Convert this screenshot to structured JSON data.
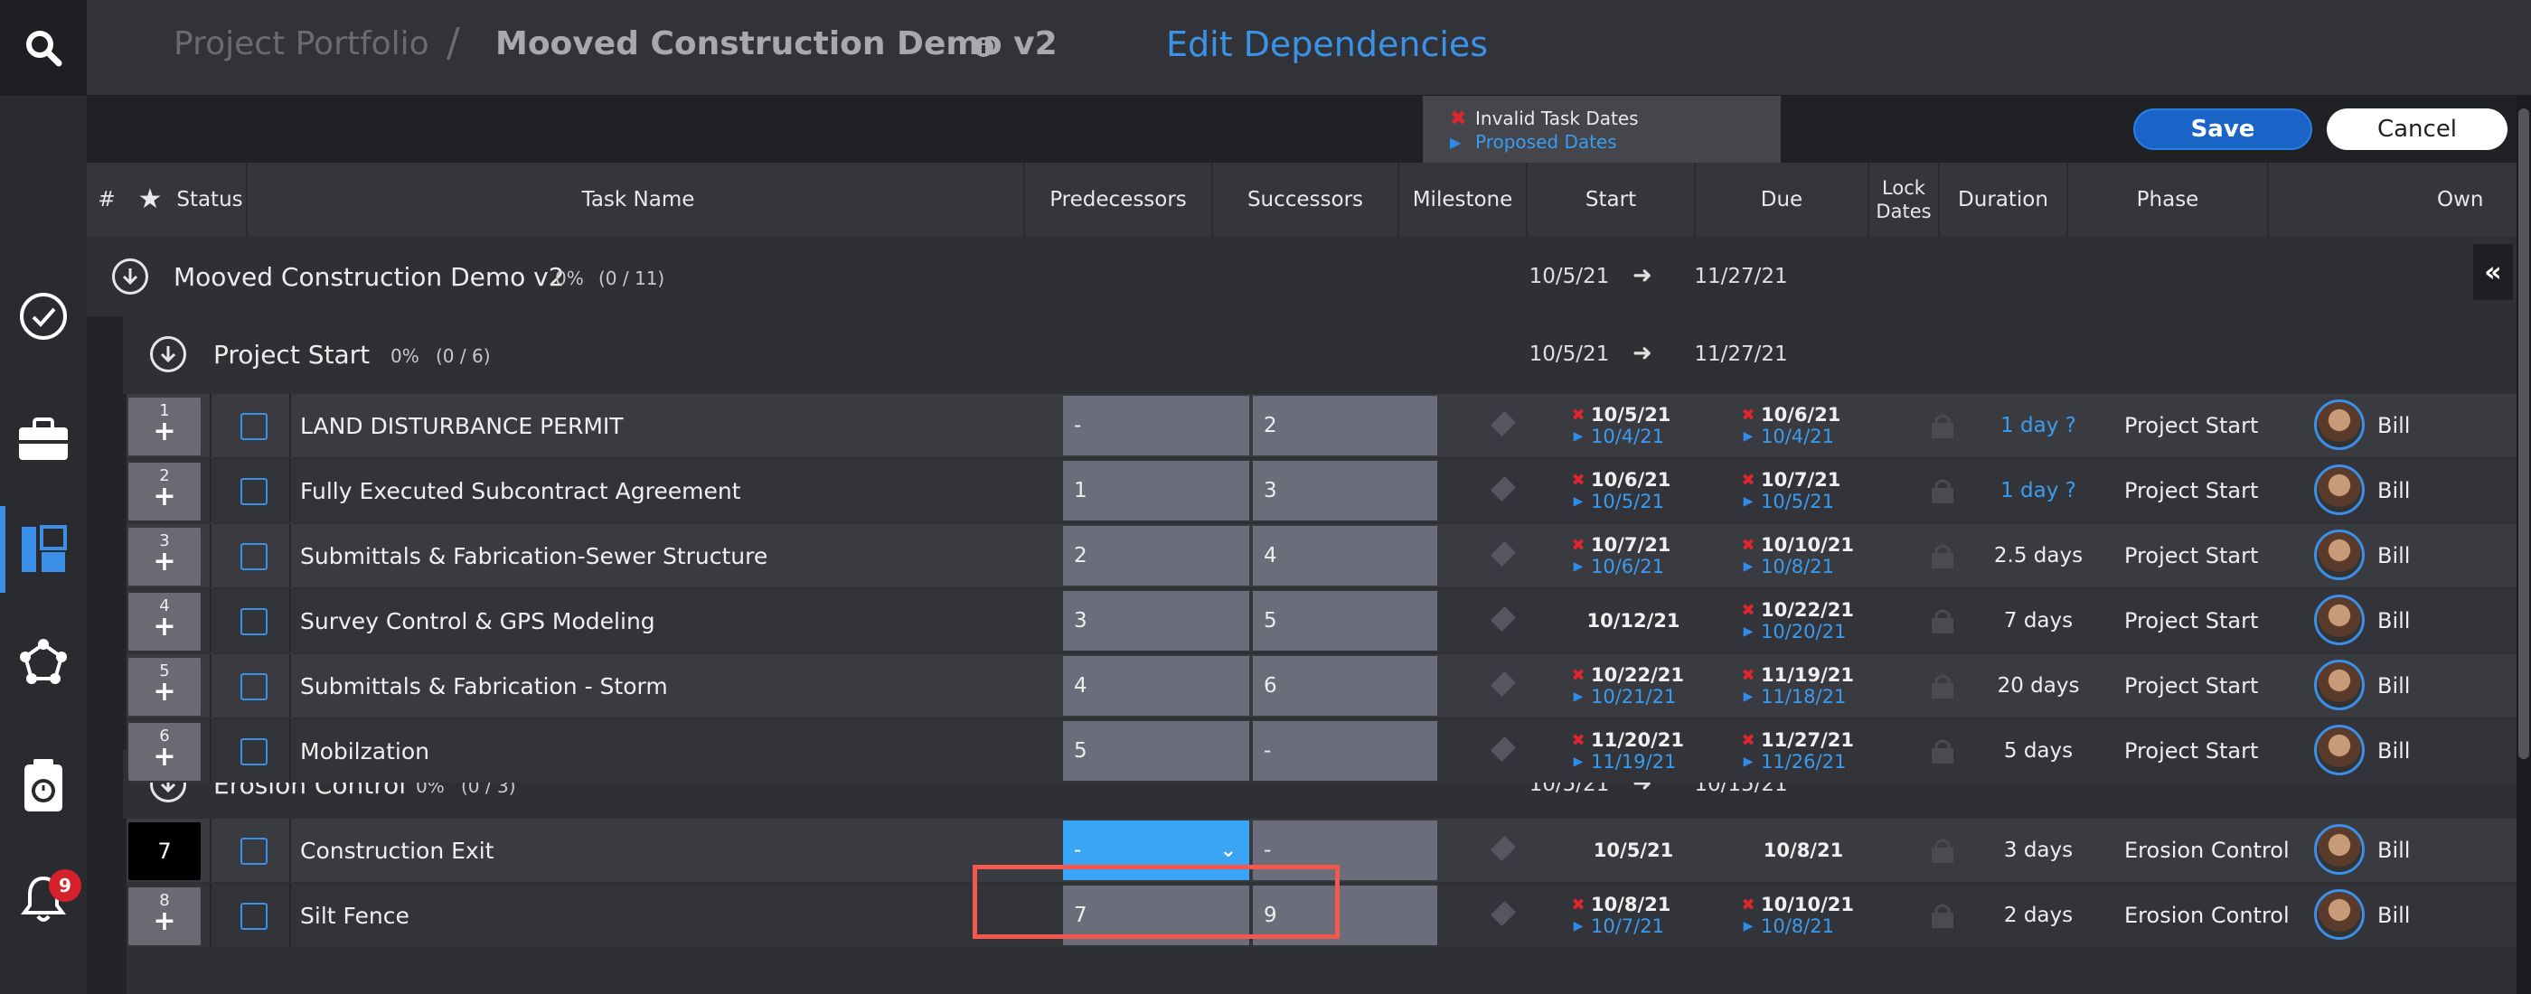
{
  "header": {
    "breadcrumb_portfolio": "Project Portfolio",
    "breadcrumb_sep": "/",
    "breadcrumb_project": "Mooved Construction Demo v2",
    "page_title": "Edit Dependencies"
  },
  "toolbar": {
    "legend_invalid": "Invalid Task Dates",
    "legend_proposed": "Proposed Dates",
    "save_label": "Save",
    "cancel_label": "Cancel"
  },
  "sidebar": {
    "notification_count": "9"
  },
  "columns": {
    "num": "#",
    "star": "★",
    "status": "Status",
    "task_name": "Task Name",
    "predecessors": "Predecessors",
    "successors": "Successors",
    "milestone": "Milestone",
    "start": "Start",
    "due": "Due",
    "lock_dates": "Lock Dates",
    "duration": "Duration",
    "phase": "Phase",
    "owner": "Own"
  },
  "project": {
    "name": "Mooved Construction Demo v2",
    "percent": "0%",
    "count": "(0 / 11)",
    "start": "10/5/21",
    "due": "11/27/21"
  },
  "groups": [
    {
      "name": "Project Start",
      "percent": "0%",
      "count": "(0 / 6)",
      "start": "10/5/21",
      "due": "11/27/21"
    },
    {
      "name": "Erosion Control",
      "percent": "0%",
      "count": "(0 / 3)",
      "start": "10/5/21",
      "due": "10/15/21"
    }
  ],
  "tasks": [
    {
      "num": "1",
      "name": "LAND DISTURBANCE PERMIT",
      "pred": "-",
      "succ": "2",
      "start": "10/5/21",
      "start_proposed": "10/4/21",
      "due": "10/6/21",
      "due_proposed": "10/4/21",
      "duration": "1 day ?",
      "phase": "Project Start",
      "owner": "Bill"
    },
    {
      "num": "2",
      "name": "Fully Executed Subcontract Agreement",
      "pred": "1",
      "succ": "3",
      "start": "10/6/21",
      "start_proposed": "10/5/21",
      "due": "10/7/21",
      "due_proposed": "10/5/21",
      "duration": "1 day ?",
      "phase": "Project Start",
      "owner": "Bill"
    },
    {
      "num": "3",
      "name": "Submittals & Fabrication-Sewer Structure",
      "pred": "2",
      "succ": "4",
      "start": "10/7/21",
      "start_proposed": "10/6/21",
      "due": "10/10/21",
      "due_proposed": "10/8/21",
      "duration": "2.5 days",
      "phase": "Project Start",
      "owner": "Bill"
    },
    {
      "num": "4",
      "name": "Survey Control & GPS Modeling",
      "pred": "3",
      "succ": "5",
      "start": "10/12/21",
      "start_proposed": "",
      "due": "10/22/21",
      "due_proposed": "10/20/21",
      "duration": "7 days",
      "phase": "Project Start",
      "owner": "Bill"
    },
    {
      "num": "5",
      "name": "Submittals & Fabrication - Storm",
      "pred": "4",
      "succ": "6",
      "start": "10/22/21",
      "start_proposed": "10/21/21",
      "due": "11/19/21",
      "due_proposed": "11/18/21",
      "duration": "20 days",
      "phase": "Project Start",
      "owner": "Bill"
    },
    {
      "num": "6",
      "name": "Mobilzation",
      "pred": "5",
      "succ": "-",
      "start": "11/20/21",
      "start_proposed": "11/19/21",
      "due": "11/27/21",
      "due_proposed": "11/26/21",
      "duration": "5 days",
      "phase": "Project Start",
      "owner": "Bill"
    },
    {
      "num": "7",
      "name": "Construction Exit",
      "pred": "-",
      "succ": "-",
      "start": "10/5/21",
      "start_proposed": "",
      "due": "10/8/21",
      "due_proposed": "",
      "duration": "3 days",
      "phase": "Erosion Control",
      "owner": "Bill"
    },
    {
      "num": "8",
      "name": "Silt Fence",
      "pred": "7",
      "succ": "9",
      "start": "10/8/21",
      "start_proposed": "10/7/21",
      "due": "10/10/21",
      "due_proposed": "10/8/21",
      "duration": "2 days",
      "phase": "Erosion Control",
      "owner": "Bill"
    }
  ]
}
